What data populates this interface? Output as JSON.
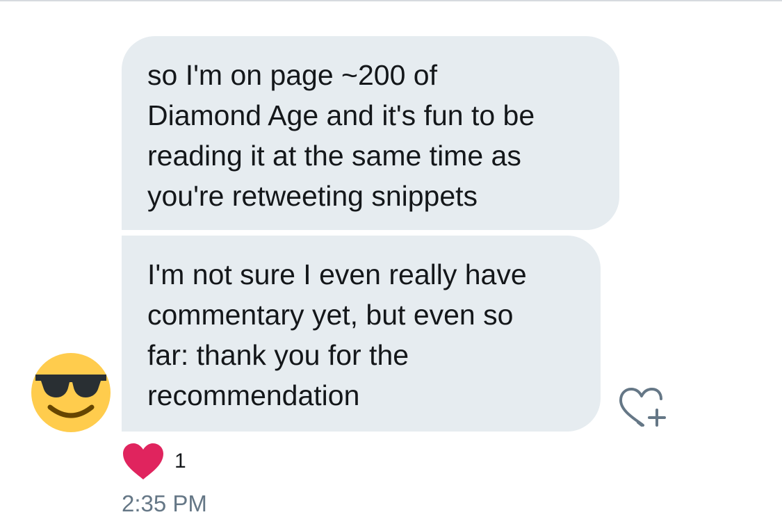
{
  "messages": [
    {
      "text": "so I'm on page ~200 of\nDiamond Age and it's fun to be\nreading it at the same time as\nyou're retweeting snippets"
    },
    {
      "text": "I'm not sure I even really have\ncommentary yet, but even so\nfar: thank you for the\nrecommendation"
    }
  ],
  "sender": {
    "avatar_icon": "sunglasses-face-emoji-icon"
  },
  "actions": {
    "add_reaction_icon": "heart-plus-icon"
  },
  "reaction": {
    "icon": "heart-icon",
    "count": "1",
    "color": "#e0245e"
  },
  "timestamp": "2:35 PM",
  "colors": {
    "bubble_background": "#e6ecf0",
    "text": "#14171a",
    "muted": "#657786",
    "avatar_yellow": "#ffcc4d"
  }
}
